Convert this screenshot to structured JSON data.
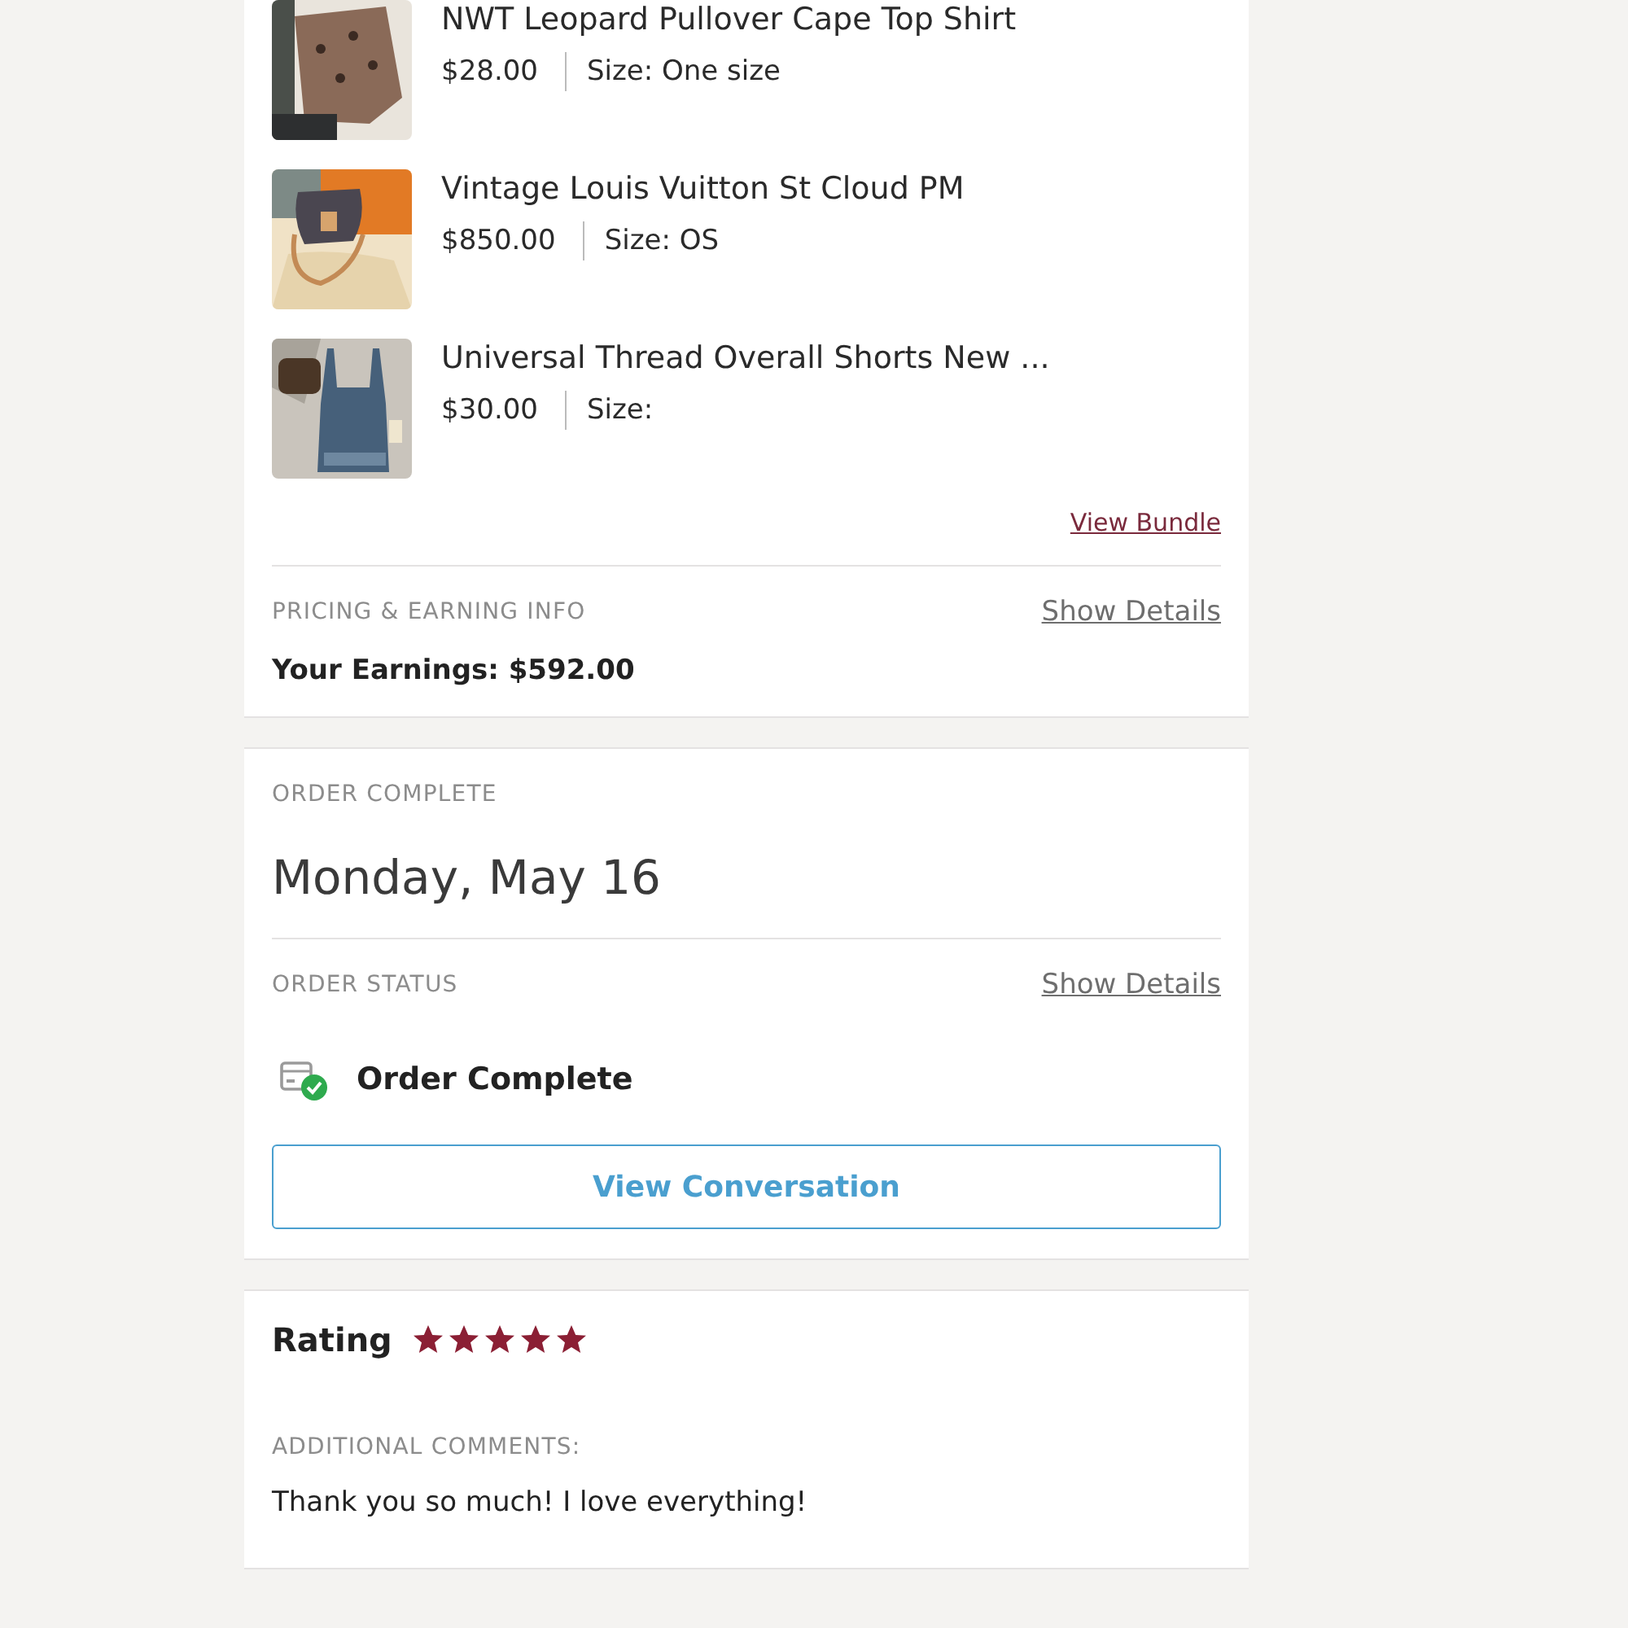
{
  "bundle_items": [
    {
      "title": "NWT Leopard Pullover Cape Top Shirt",
      "price": "$28.00",
      "size": "Size: One size"
    },
    {
      "title": "Vintage Louis Vuitton St Cloud PM",
      "price": "$850.00",
      "size": "Size: OS"
    },
    {
      "title": "Universal Thread Overall Shorts New ...",
      "price": "$30.00",
      "size": "Size:"
    }
  ],
  "view_bundle": "View Bundle",
  "pricing": {
    "heading": "PRICING & EARNING INFO",
    "details_link": "Show Details",
    "earnings": "Your Earnings: $592.00"
  },
  "order_complete": {
    "heading": "ORDER COMPLETE",
    "date": "Monday, May 16"
  },
  "order_status": {
    "heading": "ORDER STATUS",
    "details_link": "Show Details",
    "status": "Order Complete",
    "complete": true
  },
  "view_conversation": "View Conversation",
  "rating": {
    "label": "Rating",
    "stars": 5
  },
  "comments": {
    "heading": "ADDITIONAL COMMENTS:",
    "text": "Thank you so much! I love everything!"
  }
}
